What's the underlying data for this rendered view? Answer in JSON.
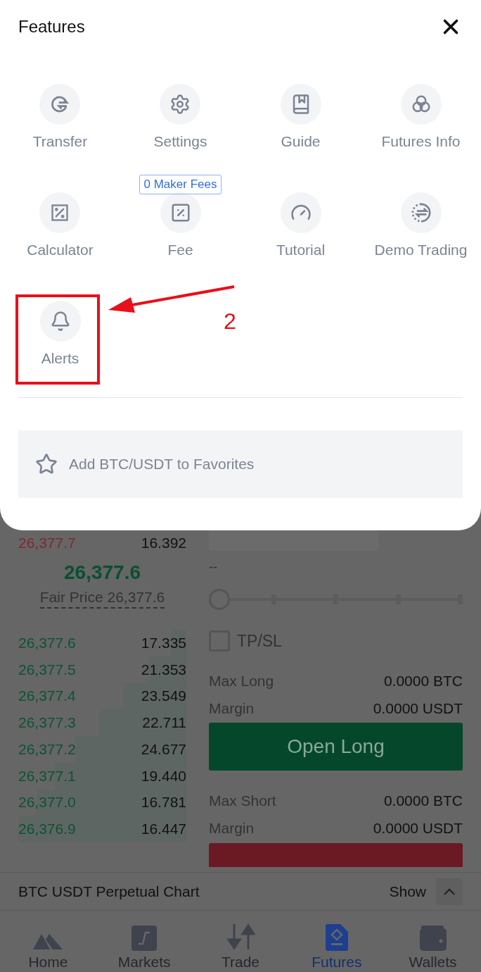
{
  "sheet": {
    "title": "Features",
    "features": [
      {
        "kind": "transfer",
        "label": "Transfer"
      },
      {
        "kind": "settings",
        "label": "Settings"
      },
      {
        "kind": "guide",
        "label": "Guide"
      },
      {
        "kind": "info",
        "label": "Futures Info"
      },
      {
        "kind": "calculator",
        "label": "Calculator"
      },
      {
        "kind": "fee",
        "label": "Fee",
        "badge": "0 Maker Fees"
      },
      {
        "kind": "tutorial",
        "label": "Tutorial"
      },
      {
        "kind": "demo",
        "label": "Demo Trading"
      },
      {
        "kind": "alerts",
        "label": "Alerts"
      }
    ],
    "favorite": "Add BTC/USDT to Favorites"
  },
  "annotation": {
    "number": "2"
  },
  "order_book": {
    "asks": [
      {
        "price": "26,377.7",
        "amount": "16.392"
      }
    ],
    "last_price": "26,377.6",
    "fair_price": "Fair Price 26,377.6",
    "bids": [
      {
        "price": "26,377.6",
        "amount": "17.335"
      },
      {
        "price": "26,377.5",
        "amount": "21.353"
      },
      {
        "price": "26,377.4",
        "amount": "23.549"
      },
      {
        "price": "26,377.3",
        "amount": "22.711"
      },
      {
        "price": "26,377.2",
        "amount": "24.677"
      },
      {
        "price": "26,377.1",
        "amount": "19.440"
      },
      {
        "price": "26,377.0",
        "amount": "16.781"
      },
      {
        "price": "26,376.9",
        "amount": "16.447"
      }
    ]
  },
  "order_form": {
    "size_hint": "--",
    "slider": {
      "level": 0
    },
    "tpsl": {
      "label": "TP/SL",
      "checked": false
    },
    "long": [
      {
        "label": "Max Long",
        "value": "0.0000 BTC"
      },
      {
        "label": "Margin",
        "value": "0.0000 USDT"
      }
    ],
    "long_button": "Open Long",
    "short": [
      {
        "label": "Max Short",
        "value": "0.0000 BTC"
      },
      {
        "label": "Margin",
        "value": "0.0000 USDT"
      }
    ]
  },
  "chart_bar": {
    "title": "BTC USDT Perpetual Chart",
    "toggle": "Show"
  },
  "nav": [
    {
      "kind": "home",
      "label": "Home",
      "selected": false
    },
    {
      "kind": "markets",
      "label": "Markets",
      "selected": false
    },
    {
      "kind": "trade",
      "label": "Trade",
      "selected": false
    },
    {
      "kind": "futures",
      "label": "Futures",
      "selected": true
    },
    {
      "kind": "wallets",
      "label": "Wallets",
      "selected": false
    }
  ]
}
